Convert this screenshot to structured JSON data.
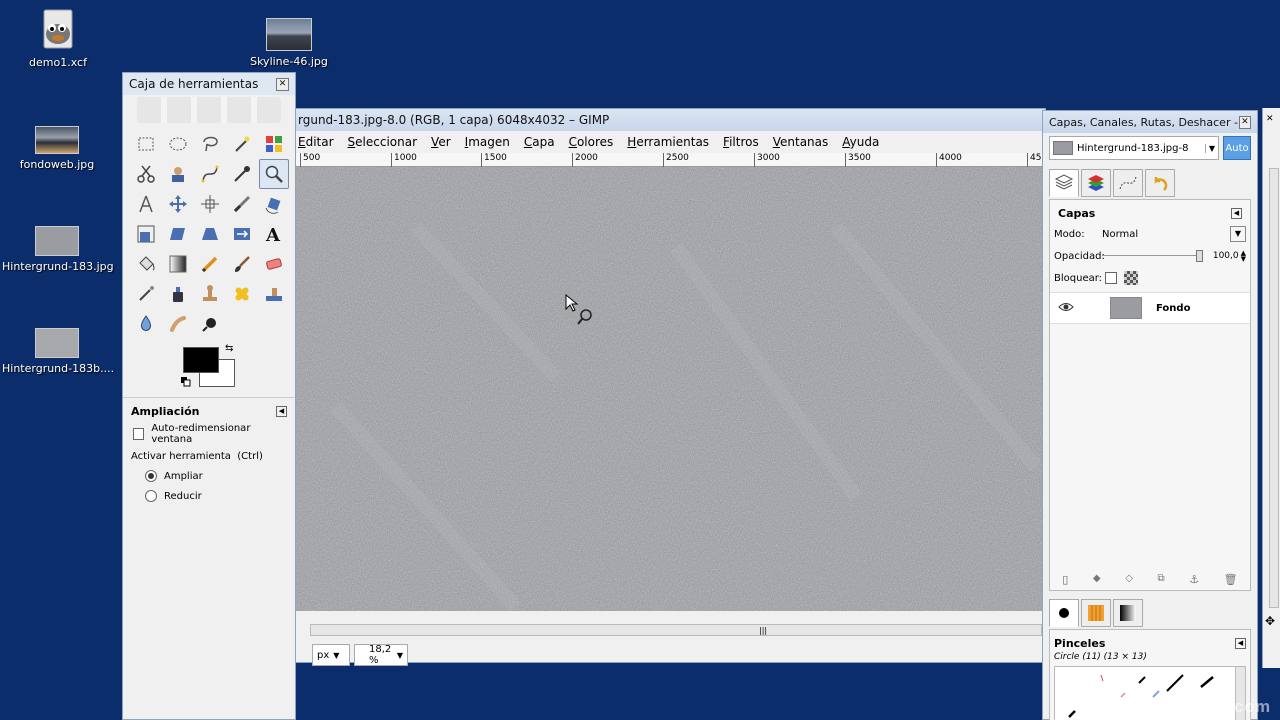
{
  "desktop": {
    "icons": [
      {
        "label": "demo1.xcf",
        "icon": "gimp-wilber-icon"
      },
      {
        "label": "Skyline-46.jpg",
        "icon": "image-thumbnail-icon"
      },
      {
        "label": "fondoweb.jpg",
        "icon": "image-thumbnail-icon"
      },
      {
        "label": "Hintergrund-183.jpg",
        "icon": "image-thumbnail-icon"
      },
      {
        "label": "Hintergrund-183b....",
        "icon": "image-thumbnail-icon"
      }
    ]
  },
  "toolbox": {
    "title": "Caja de herramientas",
    "section_title": "Ampliación",
    "auto_resize_label": "Auto-redimensionar ventana",
    "activate_label": "Activar herramienta  (Ctrl)",
    "zoom_in_label": "Ampliar",
    "zoom_out_label": "Reducir",
    "fg_color": "#000000",
    "bg_color": "#ffffff"
  },
  "image_window": {
    "title": "rgund-183.jpg-8.0 (RGB, 1 capa) 6048x4032 – GIMP",
    "menu": [
      "Editar",
      "Seleccionar",
      "Ver",
      "Imagen",
      "Capa",
      "Colores",
      "Herramientas",
      "Filtros",
      "Ventanas",
      "Ayuda"
    ],
    "ruler_labels": [
      "500",
      "1000",
      "1500",
      "2000",
      "2500",
      "3000",
      "3500",
      "4000",
      "45"
    ],
    "unit": "px",
    "zoom": "18,2 %"
  },
  "dock": {
    "title": "Capas, Canales, Rutas, Deshacer - ...",
    "image_select": "Hintergrund-183.jpg-8",
    "auto_button": "Auto",
    "layers_header": "Capas",
    "mode_label": "Modo:",
    "mode_value": "Normal",
    "opacity_label": "Opacidad:",
    "opacity_value": "100,0",
    "lock_label": "Bloquear:",
    "layer_name": "Fondo",
    "brushes_header": "Pinceles",
    "brush_name": "Circle (11) (13 × 13)"
  },
  "watermark": "video2brain.com",
  "colors": {
    "desktop_bg": "#0b2d6b",
    "accent": "#5aa0e6",
    "canvas_gray": "#8e9094"
  }
}
